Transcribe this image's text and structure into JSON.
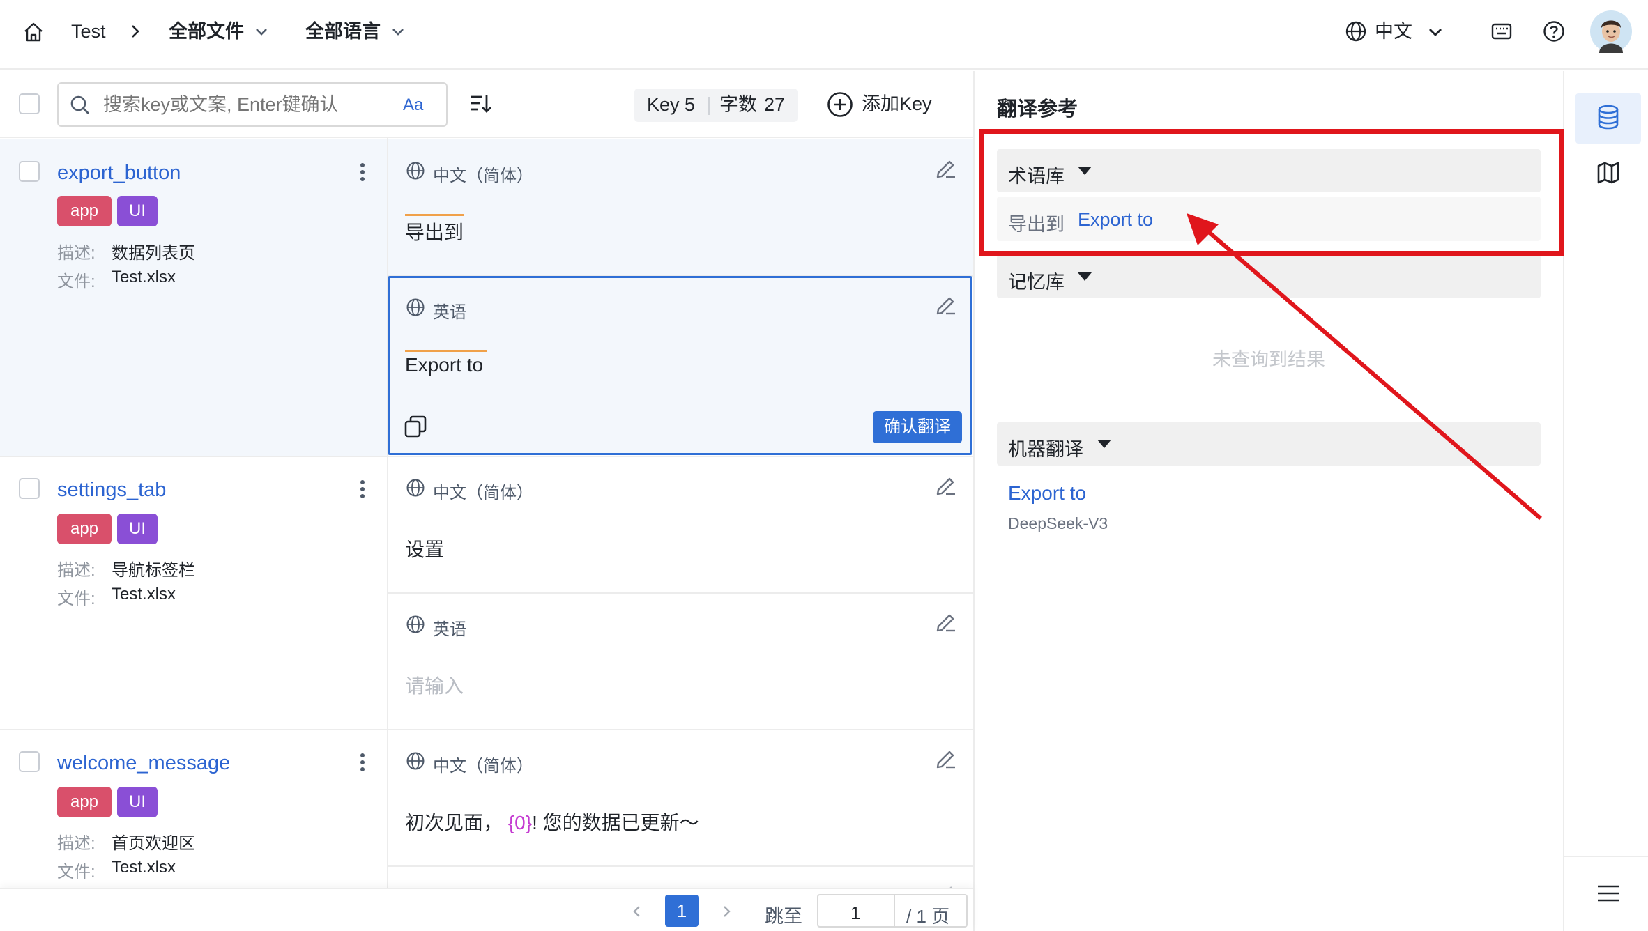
{
  "topbar": {
    "project": "Test",
    "files_dropdown": "全部文件",
    "lang_dropdown": "全部语言",
    "ui_language": "中文"
  },
  "toolbar": {
    "search_placeholder": "搜索key或文案, Enter键确认",
    "match_case": "Aa",
    "key_label": "Key",
    "key_count": "5",
    "chars_label": "字数",
    "chars_count": "27",
    "add_key": "添加Key"
  },
  "entries": [
    {
      "key": "export_button",
      "tags": [
        "app",
        "UI"
      ],
      "desc_label": "描述:",
      "desc": "数据列表页",
      "file_label": "文件:",
      "file": "Test.xlsx",
      "source_lang": "中文（简体）",
      "source_text": "导出到",
      "target_lang": "英语",
      "target_text": "Export to",
      "confirm": "确认翻译"
    },
    {
      "key": "settings_tab",
      "tags": [
        "app",
        "UI"
      ],
      "desc_label": "描述:",
      "desc": "导航标签栏",
      "file_label": "文件:",
      "file": "Test.xlsx",
      "source_lang": "中文（简体）",
      "source_text": "设置",
      "target_lang": "英语",
      "target_placeholder": "请输入"
    },
    {
      "key": "welcome_message",
      "tags": [
        "app",
        "UI"
      ],
      "desc_label": "描述:",
      "desc": "首页欢迎区",
      "file_label": "文件:",
      "file": "Test.xlsx",
      "source_lang": "中文（简体）",
      "source_text_before": "初次见面，",
      "source_placeholder": "{0}",
      "source_text_after": "! 您的数据已更新～"
    }
  ],
  "pagination": {
    "current": "1",
    "jump_label": "跳至",
    "jump_value": "1",
    "total": "/ 1 页"
  },
  "reference": {
    "title": "翻译参考",
    "termbase": "术语库",
    "term_source": "导出到",
    "term_target": "Export to",
    "memory": "记忆库",
    "memory_empty": "未查询到结果",
    "mt": "机器翻译",
    "mt_result": "Export to",
    "mt_engine": "DeepSeek-V3"
  },
  "colors": {
    "link": "#2c64d1",
    "tag_app": "#d9506b",
    "tag_ui": "#8a4fd6",
    "confirm_button": "#2f6fd6",
    "highlight_red": "#e0161c"
  }
}
